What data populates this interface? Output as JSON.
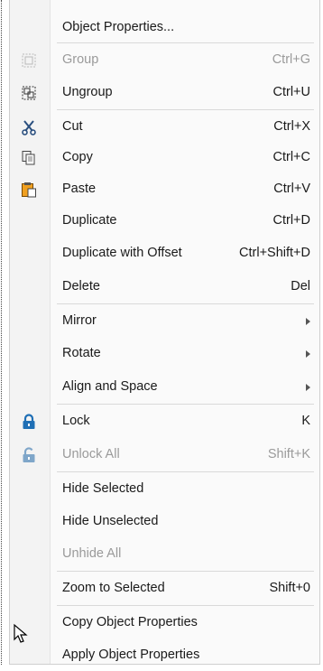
{
  "menu": {
    "items": [
      {
        "label": "Object Properties...",
        "shortcut": "",
        "disabled": false,
        "icon": ""
      },
      {
        "label": "Group",
        "shortcut": "Ctrl+G",
        "disabled": true,
        "icon": "group-icon"
      },
      {
        "label": "Ungroup",
        "shortcut": "Ctrl+U",
        "disabled": false,
        "icon": "ungroup-icon"
      },
      {
        "label": "Cut",
        "shortcut": "Ctrl+X",
        "disabled": false,
        "icon": "scissors-icon"
      },
      {
        "label": "Copy",
        "shortcut": "Ctrl+C",
        "disabled": false,
        "icon": "copy-icon"
      },
      {
        "label": "Paste",
        "shortcut": "Ctrl+V",
        "disabled": false,
        "icon": "paste-icon"
      },
      {
        "label": "Duplicate",
        "shortcut": "Ctrl+D",
        "disabled": false,
        "icon": ""
      },
      {
        "label": "Duplicate with Offset",
        "shortcut": "Ctrl+Shift+D",
        "disabled": false,
        "icon": ""
      },
      {
        "label": "Delete",
        "shortcut": "Del",
        "disabled": false,
        "icon": ""
      },
      {
        "label": "Mirror",
        "shortcut": "",
        "disabled": false,
        "icon": "",
        "submenu": true
      },
      {
        "label": "Rotate",
        "shortcut": "",
        "disabled": false,
        "icon": "",
        "submenu": true
      },
      {
        "label": "Align and Space",
        "shortcut": "",
        "disabled": false,
        "icon": "",
        "submenu": true
      },
      {
        "label": "Lock",
        "shortcut": "K",
        "disabled": false,
        "icon": "lock-icon"
      },
      {
        "label": "Unlock All",
        "shortcut": "Shift+K",
        "disabled": true,
        "icon": "unlock-icon"
      },
      {
        "label": "Hide Selected",
        "shortcut": "",
        "disabled": false,
        "icon": ""
      },
      {
        "label": "Hide Unselected",
        "shortcut": "",
        "disabled": false,
        "icon": ""
      },
      {
        "label": "Unhide All",
        "shortcut": "",
        "disabled": true,
        "icon": ""
      },
      {
        "label": "Zoom to Selected",
        "shortcut": "Shift+0",
        "disabled": false,
        "icon": ""
      },
      {
        "label": "Copy Object Properties",
        "shortcut": "",
        "disabled": false,
        "icon": ""
      },
      {
        "label": "Apply Object Properties",
        "shortcut": "",
        "disabled": false,
        "icon": ""
      }
    ]
  },
  "colors": {
    "lock_blue": "#1f6fb5",
    "disabled_text": "#9a9a9a",
    "paste_orange": "#f0a020"
  }
}
